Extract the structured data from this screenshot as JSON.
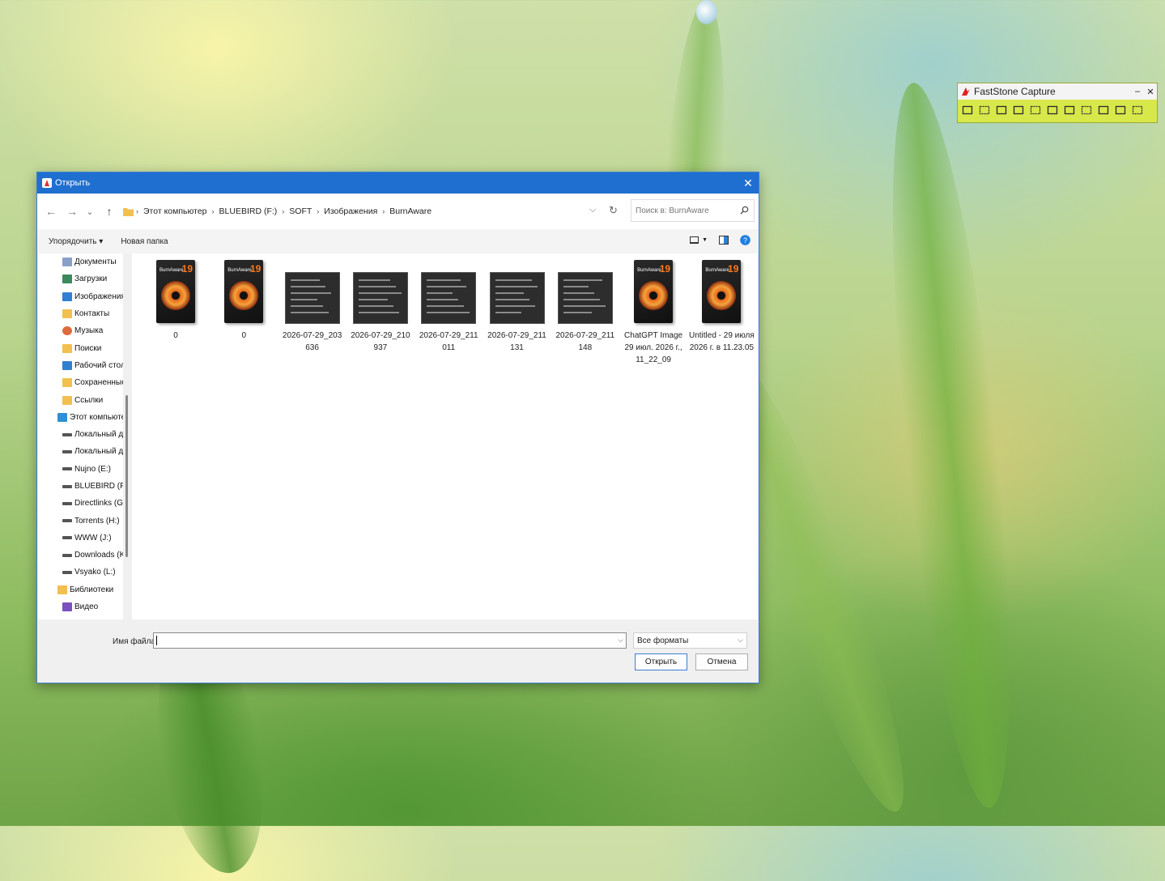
{
  "faststone": {
    "title": "FastStone Capture",
    "minimize": "–",
    "close": "✕",
    "tools": [
      "open-icon",
      "window-capture-icon",
      "rect-capture-icon",
      "freehand-capture-icon",
      "fullscreen-capture-icon",
      "scrolling-capture-icon",
      "fixed-region-icon",
      "video-record-icon",
      "timer-icon",
      "output-icon",
      "settings-icon"
    ]
  },
  "dialog": {
    "title": "Открыть",
    "close": "✕",
    "nav": {
      "back": "←",
      "forward": "→",
      "recent": "⌄",
      "up": "↑"
    },
    "breadcrumb": [
      "Этот компьютер",
      "BLUEBIRD (F:)",
      "SOFT",
      "Изображения",
      "BurnAware"
    ],
    "search_placeholder": "Поиск в: BurnAware",
    "commands": {
      "organize": "Упорядочить ▾",
      "new_folder": "Новая папка"
    },
    "sidebar": [
      {
        "label": "Документы",
        "level": 1,
        "icon": "documents-icon",
        "color": "#8aa0c8"
      },
      {
        "label": "Загрузки",
        "level": 1,
        "icon": "downloads-icon",
        "color": "#3a8a5c"
      },
      {
        "label": "Изображения",
        "level": 1,
        "icon": "pictures-icon",
        "color": "#2f7fd2"
      },
      {
        "label": "Контакты",
        "level": 1,
        "icon": "folder-icon",
        "color": "#f2c04f"
      },
      {
        "label": "Музыка",
        "level": 1,
        "icon": "music-icon",
        "color": "#e06a3b"
      },
      {
        "label": "Поиски",
        "level": 1,
        "icon": "folder-icon",
        "color": "#f2c04f"
      },
      {
        "label": "Рабочий стол",
        "level": 1,
        "icon": "desktop-icon",
        "color": "#2f7fd2"
      },
      {
        "label": "Сохраненные",
        "level": 1,
        "icon": "folder-icon",
        "color": "#f2c04f"
      },
      {
        "label": "Ссылки",
        "level": 1,
        "icon": "folder-icon",
        "color": "#f2c04f"
      },
      {
        "label": "Этот компьютер",
        "level": 0,
        "icon": "computer-icon",
        "color": "#2f8fd8"
      },
      {
        "label": "Локальный ди",
        "level": 1,
        "icon": "drive-c-icon",
        "color": "#555555"
      },
      {
        "label": "Локальный ди",
        "level": 1,
        "icon": "drive-icon",
        "color": "#555555"
      },
      {
        "label": "Nujno (E:)",
        "level": 1,
        "icon": "drive-icon",
        "color": "#555555"
      },
      {
        "label": "BLUEBIRD (F:)",
        "level": 1,
        "icon": "drive-icon",
        "color": "#555555"
      },
      {
        "label": "Directlinks (G:)",
        "level": 1,
        "icon": "drive-icon",
        "color": "#555555"
      },
      {
        "label": "Torrents (H:)",
        "level": 1,
        "icon": "drive-icon",
        "color": "#555555"
      },
      {
        "label": "WWW (J:)",
        "level": 1,
        "icon": "drive-icon",
        "color": "#555555"
      },
      {
        "label": "Downloads (K:",
        "level": 1,
        "icon": "drive-icon",
        "color": "#555555"
      },
      {
        "label": "Vsyako (L:)",
        "level": 1,
        "icon": "drive-icon",
        "color": "#555555"
      },
      {
        "label": "Библиотеки",
        "level": 0,
        "icon": "libraries-icon",
        "color": "#f2c04f"
      },
      {
        "label": "Видео",
        "level": 1,
        "icon": "video-icon",
        "color": "#7a4fc0"
      }
    ],
    "files": [
      {
        "label": "0",
        "kind": "box"
      },
      {
        "label": "0",
        "kind": "box"
      },
      {
        "label": "2026-07-29_203 636",
        "kind": "shot"
      },
      {
        "label": "2026-07-29_210 937",
        "kind": "shot"
      },
      {
        "label": "2026-07-29_211 011",
        "kind": "shot"
      },
      {
        "label": "2026-07-29_211 131",
        "kind": "shot"
      },
      {
        "label": "2026-07-29_211 148",
        "kind": "shot"
      },
      {
        "label": "ChatGPT Image 29 июл. 2026 г., 11_22_09",
        "kind": "box"
      },
      {
        "label": "Untitled - 29 июля 2026 г. в 11.23.05",
        "kind": "box"
      }
    ],
    "box_art": {
      "brand": "BurnAware",
      "number": "19"
    },
    "filename_label": "Имя файла:",
    "filename_value": "",
    "filetype": "Все форматы",
    "open_button": "Открыть",
    "cancel_button": "Отмена"
  }
}
